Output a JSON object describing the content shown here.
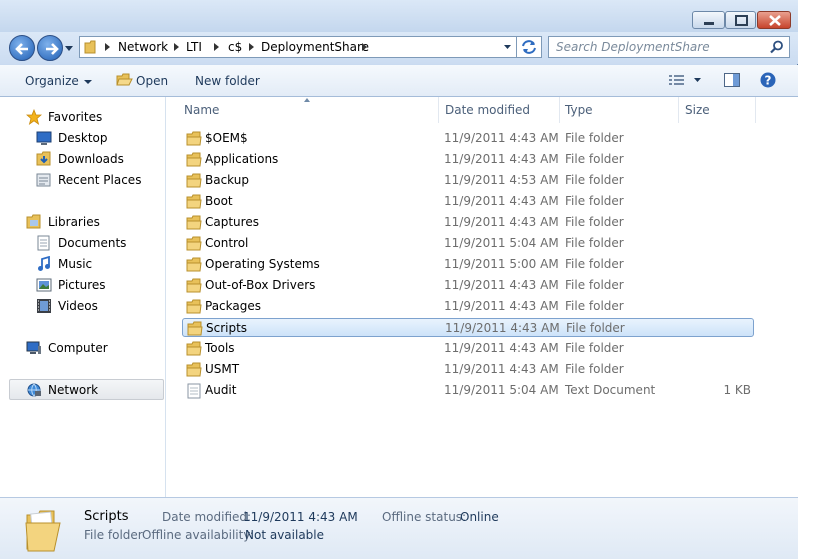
{
  "address": {
    "crumbs": [
      "Network",
      "LTI",
      "c$",
      "DeploymentShare"
    ]
  },
  "search": {
    "placeholder": "Search DeploymentShare"
  },
  "toolbar": {
    "organize_label": "Organize",
    "open_label": "Open",
    "new_folder_label": "New folder"
  },
  "nav": {
    "favorites": "Favorites",
    "desktop": "Desktop",
    "downloads": "Downloads",
    "recent": "Recent Places",
    "libraries": "Libraries",
    "documents": "Documents",
    "music": "Music",
    "pictures": "Pictures",
    "videos": "Videos",
    "computer": "Computer",
    "network": "Network"
  },
  "columns": {
    "name": "Name",
    "date": "Date modified",
    "type": "Type",
    "size": "Size"
  },
  "files": [
    {
      "name": "$OEM$",
      "date": "11/9/2011 4:43 AM",
      "type": "File folder",
      "size": ""
    },
    {
      "name": "Applications",
      "date": "11/9/2011 4:43 AM",
      "type": "File folder",
      "size": ""
    },
    {
      "name": "Backup",
      "date": "11/9/2011 4:53 AM",
      "type": "File folder",
      "size": ""
    },
    {
      "name": "Boot",
      "date": "11/9/2011 4:43 AM",
      "type": "File folder",
      "size": ""
    },
    {
      "name": "Captures",
      "date": "11/9/2011 4:43 AM",
      "type": "File folder",
      "size": ""
    },
    {
      "name": "Control",
      "date": "11/9/2011 5:04 AM",
      "type": "File folder",
      "size": ""
    },
    {
      "name": "Operating Systems",
      "date": "11/9/2011 5:00 AM",
      "type": "File folder",
      "size": ""
    },
    {
      "name": "Out-of-Box Drivers",
      "date": "11/9/2011 4:43 AM",
      "type": "File folder",
      "size": ""
    },
    {
      "name": "Packages",
      "date": "11/9/2011 4:43 AM",
      "type": "File folder",
      "size": ""
    },
    {
      "name": "Scripts",
      "date": "11/9/2011 4:43 AM",
      "type": "File folder",
      "size": ""
    },
    {
      "name": "Tools",
      "date": "11/9/2011 4:43 AM",
      "type": "File folder",
      "size": ""
    },
    {
      "name": "USMT",
      "date": "11/9/2011 4:43 AM",
      "type": "File folder",
      "size": ""
    },
    {
      "name": "Audit",
      "date": "11/9/2011 5:04 AM",
      "type": "Text Document",
      "size": "1 KB"
    }
  ],
  "selected_index": 9,
  "details": {
    "name": "Scripts",
    "kind": "File folder",
    "date_label": "Date modified:",
    "date_value": "11/9/2011 4:43 AM",
    "offline_avail_label": "Offline availability:",
    "offline_avail_value": "Not available",
    "offline_status_label": "Offline status:",
    "offline_status_value": "Online"
  },
  "colors": {
    "accent": "#1f5fb4",
    "selection": "#cde3f9",
    "folder": "#e8c15a",
    "close": "#c7442c"
  },
  "icons": {
    "back": "back-arrow-icon",
    "forward": "forward-arrow-icon",
    "folder": "folder-icon",
    "text_document": "text-document-icon",
    "help": "help-icon"
  }
}
